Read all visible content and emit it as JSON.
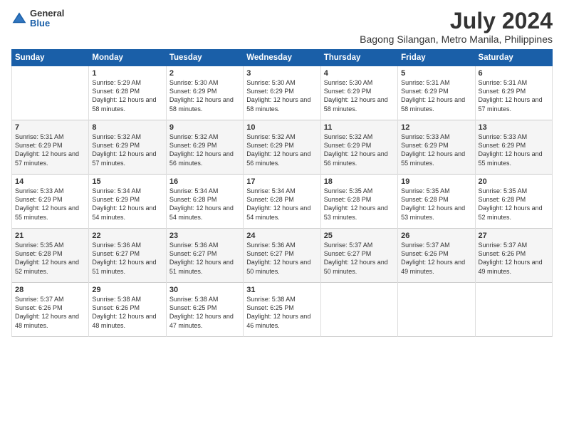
{
  "logo": {
    "general": "General",
    "blue": "Blue"
  },
  "title": "July 2024",
  "subtitle": "Bagong Silangan, Metro Manila, Philippines",
  "days": [
    "Sunday",
    "Monday",
    "Tuesday",
    "Wednesday",
    "Thursday",
    "Friday",
    "Saturday"
  ],
  "weeks": [
    [
      {
        "num": "",
        "sunrise": "",
        "sunset": "",
        "daylight": ""
      },
      {
        "num": "1",
        "sunrise": "Sunrise: 5:29 AM",
        "sunset": "Sunset: 6:28 PM",
        "daylight": "Daylight: 12 hours and 58 minutes."
      },
      {
        "num": "2",
        "sunrise": "Sunrise: 5:30 AM",
        "sunset": "Sunset: 6:29 PM",
        "daylight": "Daylight: 12 hours and 58 minutes."
      },
      {
        "num": "3",
        "sunrise": "Sunrise: 5:30 AM",
        "sunset": "Sunset: 6:29 PM",
        "daylight": "Daylight: 12 hours and 58 minutes."
      },
      {
        "num": "4",
        "sunrise": "Sunrise: 5:30 AM",
        "sunset": "Sunset: 6:29 PM",
        "daylight": "Daylight: 12 hours and 58 minutes."
      },
      {
        "num": "5",
        "sunrise": "Sunrise: 5:31 AM",
        "sunset": "Sunset: 6:29 PM",
        "daylight": "Daylight: 12 hours and 58 minutes."
      },
      {
        "num": "6",
        "sunrise": "Sunrise: 5:31 AM",
        "sunset": "Sunset: 6:29 PM",
        "daylight": "Daylight: 12 hours and 57 minutes."
      }
    ],
    [
      {
        "num": "7",
        "sunrise": "Sunrise: 5:31 AM",
        "sunset": "Sunset: 6:29 PM",
        "daylight": "Daylight: 12 hours and 57 minutes."
      },
      {
        "num": "8",
        "sunrise": "Sunrise: 5:32 AM",
        "sunset": "Sunset: 6:29 PM",
        "daylight": "Daylight: 12 hours and 57 minutes."
      },
      {
        "num": "9",
        "sunrise": "Sunrise: 5:32 AM",
        "sunset": "Sunset: 6:29 PM",
        "daylight": "Daylight: 12 hours and 56 minutes."
      },
      {
        "num": "10",
        "sunrise": "Sunrise: 5:32 AM",
        "sunset": "Sunset: 6:29 PM",
        "daylight": "Daylight: 12 hours and 56 minutes."
      },
      {
        "num": "11",
        "sunrise": "Sunrise: 5:32 AM",
        "sunset": "Sunset: 6:29 PM",
        "daylight": "Daylight: 12 hours and 56 minutes."
      },
      {
        "num": "12",
        "sunrise": "Sunrise: 5:33 AM",
        "sunset": "Sunset: 6:29 PM",
        "daylight": "Daylight: 12 hours and 55 minutes."
      },
      {
        "num": "13",
        "sunrise": "Sunrise: 5:33 AM",
        "sunset": "Sunset: 6:29 PM",
        "daylight": "Daylight: 12 hours and 55 minutes."
      }
    ],
    [
      {
        "num": "14",
        "sunrise": "Sunrise: 5:33 AM",
        "sunset": "Sunset: 6:29 PM",
        "daylight": "Daylight: 12 hours and 55 minutes."
      },
      {
        "num": "15",
        "sunrise": "Sunrise: 5:34 AM",
        "sunset": "Sunset: 6:29 PM",
        "daylight": "Daylight: 12 hours and 54 minutes."
      },
      {
        "num": "16",
        "sunrise": "Sunrise: 5:34 AM",
        "sunset": "Sunset: 6:28 PM",
        "daylight": "Daylight: 12 hours and 54 minutes."
      },
      {
        "num": "17",
        "sunrise": "Sunrise: 5:34 AM",
        "sunset": "Sunset: 6:28 PM",
        "daylight": "Daylight: 12 hours and 54 minutes."
      },
      {
        "num": "18",
        "sunrise": "Sunrise: 5:35 AM",
        "sunset": "Sunset: 6:28 PM",
        "daylight": "Daylight: 12 hours and 53 minutes."
      },
      {
        "num": "19",
        "sunrise": "Sunrise: 5:35 AM",
        "sunset": "Sunset: 6:28 PM",
        "daylight": "Daylight: 12 hours and 53 minutes."
      },
      {
        "num": "20",
        "sunrise": "Sunrise: 5:35 AM",
        "sunset": "Sunset: 6:28 PM",
        "daylight": "Daylight: 12 hours and 52 minutes."
      }
    ],
    [
      {
        "num": "21",
        "sunrise": "Sunrise: 5:35 AM",
        "sunset": "Sunset: 6:28 PM",
        "daylight": "Daylight: 12 hours and 52 minutes."
      },
      {
        "num": "22",
        "sunrise": "Sunrise: 5:36 AM",
        "sunset": "Sunset: 6:27 PM",
        "daylight": "Daylight: 12 hours and 51 minutes."
      },
      {
        "num": "23",
        "sunrise": "Sunrise: 5:36 AM",
        "sunset": "Sunset: 6:27 PM",
        "daylight": "Daylight: 12 hours and 51 minutes."
      },
      {
        "num": "24",
        "sunrise": "Sunrise: 5:36 AM",
        "sunset": "Sunset: 6:27 PM",
        "daylight": "Daylight: 12 hours and 50 minutes."
      },
      {
        "num": "25",
        "sunrise": "Sunrise: 5:37 AM",
        "sunset": "Sunset: 6:27 PM",
        "daylight": "Daylight: 12 hours and 50 minutes."
      },
      {
        "num": "26",
        "sunrise": "Sunrise: 5:37 AM",
        "sunset": "Sunset: 6:26 PM",
        "daylight": "Daylight: 12 hours and 49 minutes."
      },
      {
        "num": "27",
        "sunrise": "Sunrise: 5:37 AM",
        "sunset": "Sunset: 6:26 PM",
        "daylight": "Daylight: 12 hours and 49 minutes."
      }
    ],
    [
      {
        "num": "28",
        "sunrise": "Sunrise: 5:37 AM",
        "sunset": "Sunset: 6:26 PM",
        "daylight": "Daylight: 12 hours and 48 minutes."
      },
      {
        "num": "29",
        "sunrise": "Sunrise: 5:38 AM",
        "sunset": "Sunset: 6:26 PM",
        "daylight": "Daylight: 12 hours and 48 minutes."
      },
      {
        "num": "30",
        "sunrise": "Sunrise: 5:38 AM",
        "sunset": "Sunset: 6:25 PM",
        "daylight": "Daylight: 12 hours and 47 minutes."
      },
      {
        "num": "31",
        "sunrise": "Sunrise: 5:38 AM",
        "sunset": "Sunset: 6:25 PM",
        "daylight": "Daylight: 12 hours and 46 minutes."
      },
      {
        "num": "",
        "sunrise": "",
        "sunset": "",
        "daylight": ""
      },
      {
        "num": "",
        "sunrise": "",
        "sunset": "",
        "daylight": ""
      },
      {
        "num": "",
        "sunrise": "",
        "sunset": "",
        "daylight": ""
      }
    ]
  ]
}
